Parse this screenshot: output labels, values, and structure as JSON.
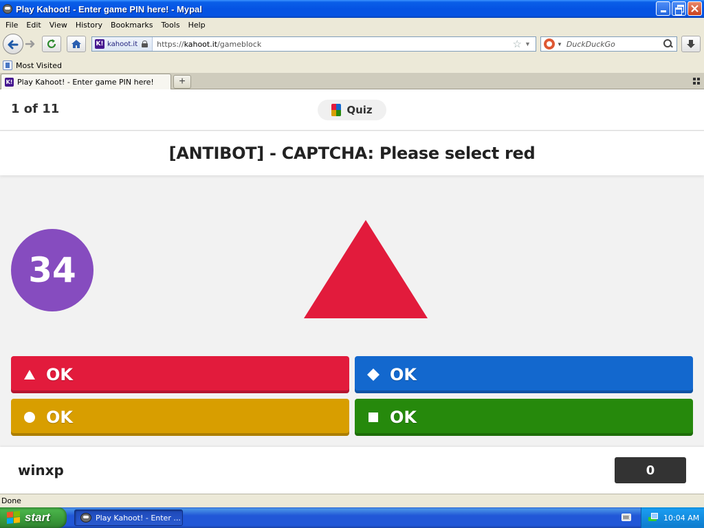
{
  "window": {
    "title": "Play Kahoot! - Enter game PIN here! - Mypal"
  },
  "menu": {
    "items": [
      "File",
      "Edit",
      "View",
      "History",
      "Bookmarks",
      "Tools",
      "Help"
    ]
  },
  "navbar": {
    "site_name": "kahoot.it",
    "url_scheme": "https://",
    "url_host": "kahoot.it",
    "url_path": "/gameblock",
    "search_placeholder": "DuckDuckGo",
    "logo_text": "K!"
  },
  "bookmarks": {
    "items": [
      "Most Visited"
    ]
  },
  "tabs": [
    {
      "label": "Play Kahoot! - Enter game PIN here!",
      "active": true
    }
  ],
  "new_tab_label": "+",
  "game": {
    "question_counter": "1 of 11",
    "mode_label": "Quiz",
    "question": "[ANTIBOT] - CAPTCHA: Please select red",
    "timer": "34",
    "shape": "red-triangle",
    "answers": [
      {
        "label": "OK",
        "shape": "triangle-icon",
        "color": "#e21b3c"
      },
      {
        "label": "OK",
        "shape": "diamond-icon",
        "color": "#1368ce"
      },
      {
        "label": "OK",
        "shape": "circle-icon",
        "color": "#d89e00"
      },
      {
        "label": "OK",
        "shape": "square-icon",
        "color": "#26890c"
      }
    ],
    "player_name": "winxp",
    "score": "0"
  },
  "colors": {
    "timer": "#864cbf",
    "shape_fill": "#e21b3c",
    "score_bg": "#333333",
    "titlebar": "#0553e3"
  },
  "status": {
    "text": "Done"
  },
  "taskbar": {
    "start_label": "start",
    "task_label": "Play Kahoot! - Enter ...",
    "clock": "10:04 AM"
  }
}
